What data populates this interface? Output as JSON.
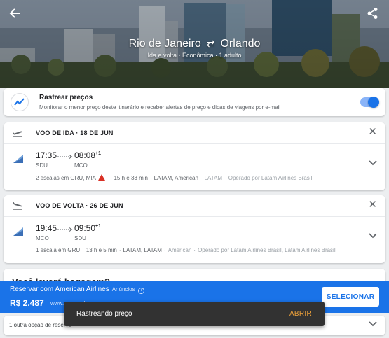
{
  "header": {
    "origin": "Rio de Janeiro",
    "destination": "Orlando",
    "subtitle": "Ida e volta · Econômica · 1 adulto",
    "back_icon": "arrow-back-icon",
    "share_icon": "share-icon"
  },
  "track_prices": {
    "title": "Rastrear preços",
    "description": "Monitorar o menor preço deste itinerário e receber alertas de preço e dicas de viagens por e-mail",
    "toggle_on": true,
    "icon": "trend-chart-icon"
  },
  "outbound": {
    "title": "VOO DE IDA · 18 DE JUN",
    "dep_time": "17:35",
    "arr_time": "08:08",
    "day_offset": "+1",
    "dep_airport": "SDU",
    "arr_airport": "MCO",
    "stops": "2 escalas em GRU, MIA",
    "duration": "15 h e 33 min",
    "airlines": "LATAM, American",
    "marketing": "LATAM",
    "operated": "Operado por Latam Airlines Brasil"
  },
  "return": {
    "title": "VOO DE VOLTA · 26 DE JUN",
    "dep_time": "19:45",
    "arr_time": "09:50",
    "day_offset": "+1",
    "dep_airport": "MCO",
    "arr_airport": "SDU",
    "stops": "1 escala em GRU",
    "duration": "13 h e 5 min",
    "airlines": "LATAM, LATAM",
    "marketing": "American",
    "operated": "Operado por Latam Airlines Brasil, Latam Airlines Brasil"
  },
  "baggage": {
    "question": "Você levará bagagem?"
  },
  "booking": {
    "title": "Reservar com American Airlines",
    "ads_label": "Anúncios",
    "price": "R$ 2.487",
    "url": "www.aa.com.br",
    "select_label": "SELECIONAR"
  },
  "other_options": {
    "text": "1 outra opção de reserva"
  },
  "snackbar": {
    "message": "Rastreando preço",
    "action": "ABRIR"
  },
  "colors": {
    "accent": "#1a73e8",
    "warning": "#d93025",
    "snackbar_action": "#f0a33a"
  }
}
